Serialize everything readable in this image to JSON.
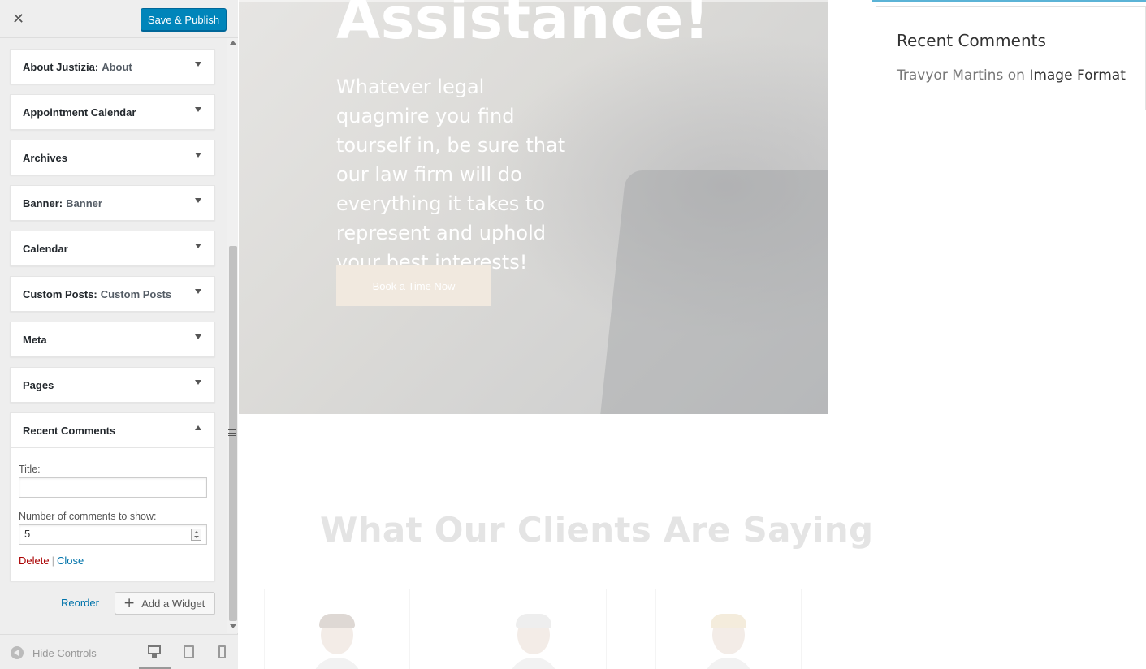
{
  "header": {
    "close_label": "✕",
    "save_label": "Save & Publish"
  },
  "widgets": [
    {
      "title": "About Justizia",
      "subtitle": "About"
    },
    {
      "title": "Appointment Calendar",
      "subtitle": ""
    },
    {
      "title": "Archives",
      "subtitle": ""
    },
    {
      "title": "Banner",
      "subtitle": "Banner"
    },
    {
      "title": "Calendar",
      "subtitle": ""
    },
    {
      "title": "Custom Posts",
      "subtitle": "Custom Posts"
    },
    {
      "title": "Meta",
      "subtitle": ""
    },
    {
      "title": "Pages",
      "subtitle": ""
    }
  ],
  "expanded_widget": {
    "title": "Recent Comments",
    "title_label": "Title:",
    "title_value": "",
    "number_label": "Number of comments to show:",
    "number_value": "5",
    "delete_label": "Delete",
    "separator": "|",
    "close_label": "Close"
  },
  "actions": {
    "reorder_label": "Reorder",
    "add_widget_label": "Add a Widget",
    "add_icon": "+"
  },
  "footer": {
    "hide_controls_label": "Hide Controls",
    "active_device": "desktop"
  },
  "preview": {
    "hero_title": "Assistance!",
    "hero_text": "Whatever legal quagmire you find tourself in, be sure that our law firm will do everything it takes to represent and uphold your best interests!",
    "hero_button": "Book a Time Now",
    "clients_title": "What Our Clients Are Saying",
    "recent_comments": {
      "title": "Recent Comments",
      "author": "Travyor Martins",
      "on_word": "on",
      "post": "Image Format"
    }
  },
  "colors": {
    "primary_button": "#0085ba",
    "delete_link": "#aa0000",
    "link": "#0073aa",
    "sidebar_bg": "#eeeeee"
  }
}
